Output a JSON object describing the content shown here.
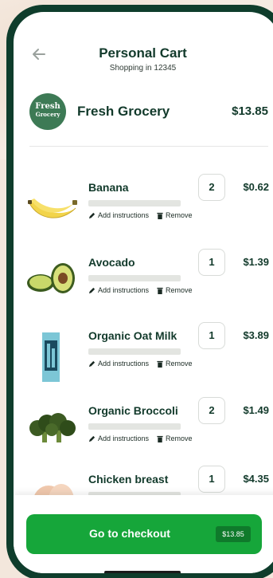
{
  "header": {
    "title": "Personal Cart",
    "subtitle": "Shopping in 12345"
  },
  "store": {
    "logo_line1": "Fresh",
    "logo_line2": "Grocery",
    "name": "Fresh Grocery",
    "total": "$13.85"
  },
  "actions": {
    "add_instructions": "Add instructions",
    "remove": "Remove"
  },
  "items": [
    {
      "name": "Banana",
      "quantity": "2",
      "price": "$0.62"
    },
    {
      "name": "Avocado",
      "quantity": "1",
      "price": "$1.39"
    },
    {
      "name": "Organic Oat Milk",
      "quantity": "1",
      "price": "$3.89"
    },
    {
      "name": "Organic Broccoli",
      "quantity": "2",
      "price": "$1.49"
    },
    {
      "name": "Chicken breast",
      "quantity": "1",
      "price": "$4.35"
    }
  ],
  "checkout": {
    "label": "Go to checkout",
    "total_badge": "$13.85"
  },
  "colors": {
    "brand_dark": "#123a2b",
    "checkout_green": "#16a63a",
    "logo_green": "#3d7a55"
  },
  "icons": [
    "back-arrow-icon",
    "pencil-icon",
    "trash-icon"
  ]
}
